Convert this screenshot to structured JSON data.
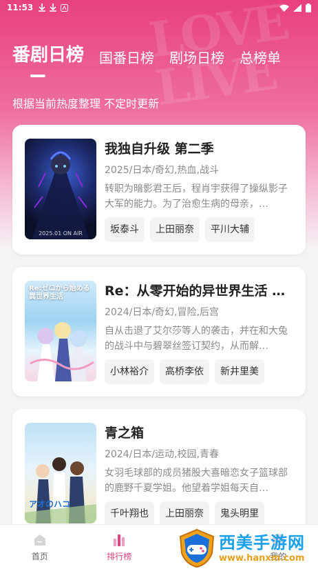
{
  "status_bar": {
    "time": "11:53",
    "left_icons": [
      "download-icon",
      "download-icon",
      "app-icon"
    ],
    "right_icons": [
      "wifi-icon",
      "signal-icon",
      "battery-icon"
    ]
  },
  "colors": {
    "accent": "#e8407f",
    "header_gradient_top": "#e8407f",
    "text_dark": "#222222",
    "text_muted": "#8a8a8a",
    "tag_bg": "#f3f3f5"
  },
  "tabs": [
    {
      "label": "番剧日榜",
      "active": true
    },
    {
      "label": "国番日榜",
      "active": false
    },
    {
      "label": "剧场日榜",
      "active": false
    },
    {
      "label": "总榜单",
      "active": false
    }
  ],
  "subtitle": "根据当前热度整理 不定时更新",
  "cards": [
    {
      "title": "我独自升级 第二季",
      "meta": "2025/日本/奇幻,热血,战斗",
      "desc": "转职为暗影君王后，程肖宇获得了操纵影子大军的能力。为了治愈生病的母亲，…",
      "tags": [
        "坂泰斗",
        "上田丽奈",
        "平川大辅"
      ],
      "poster_caption": "2025.01 ON AIR"
    },
    {
      "title": "Re：从零开始的异世界生活 …",
      "meta": "2024/日本/奇幻,冒险,后宫",
      "desc": "自从击退了艾尔莎等人的袭击，并在和大兔的战斗中与碧翠丝签订契约，从而解…",
      "tags": [
        "小林裕介",
        "高桥李依",
        "新井里美"
      ],
      "poster_logo": "Re:ゼロから始める異世界生活"
    },
    {
      "title": "青之箱",
      "meta": "2024/日本/运动,校园,青春",
      "desc": "女羽毛球部的成员猪股大喜暗恋女子篮球部的鹿野千夏学姐。他望着学姐每天自…",
      "tags": [
        "千叶翔也",
        "上田丽奈",
        "鬼头明里"
      ],
      "poster_logo": "アオのハコ"
    }
  ],
  "bottom_nav": [
    {
      "label": "首页",
      "icon": "home-icon",
      "active": false
    },
    {
      "label": "排行榜",
      "icon": "ranking-icon",
      "active": true
    },
    {
      "label": "",
      "icon": "",
      "active": false
    },
    {
      "label": "我的",
      "icon": "profile-icon",
      "active": false
    }
  ],
  "watermark": {
    "title": "西美手游网",
    "url": "www.hanxm.com"
  }
}
